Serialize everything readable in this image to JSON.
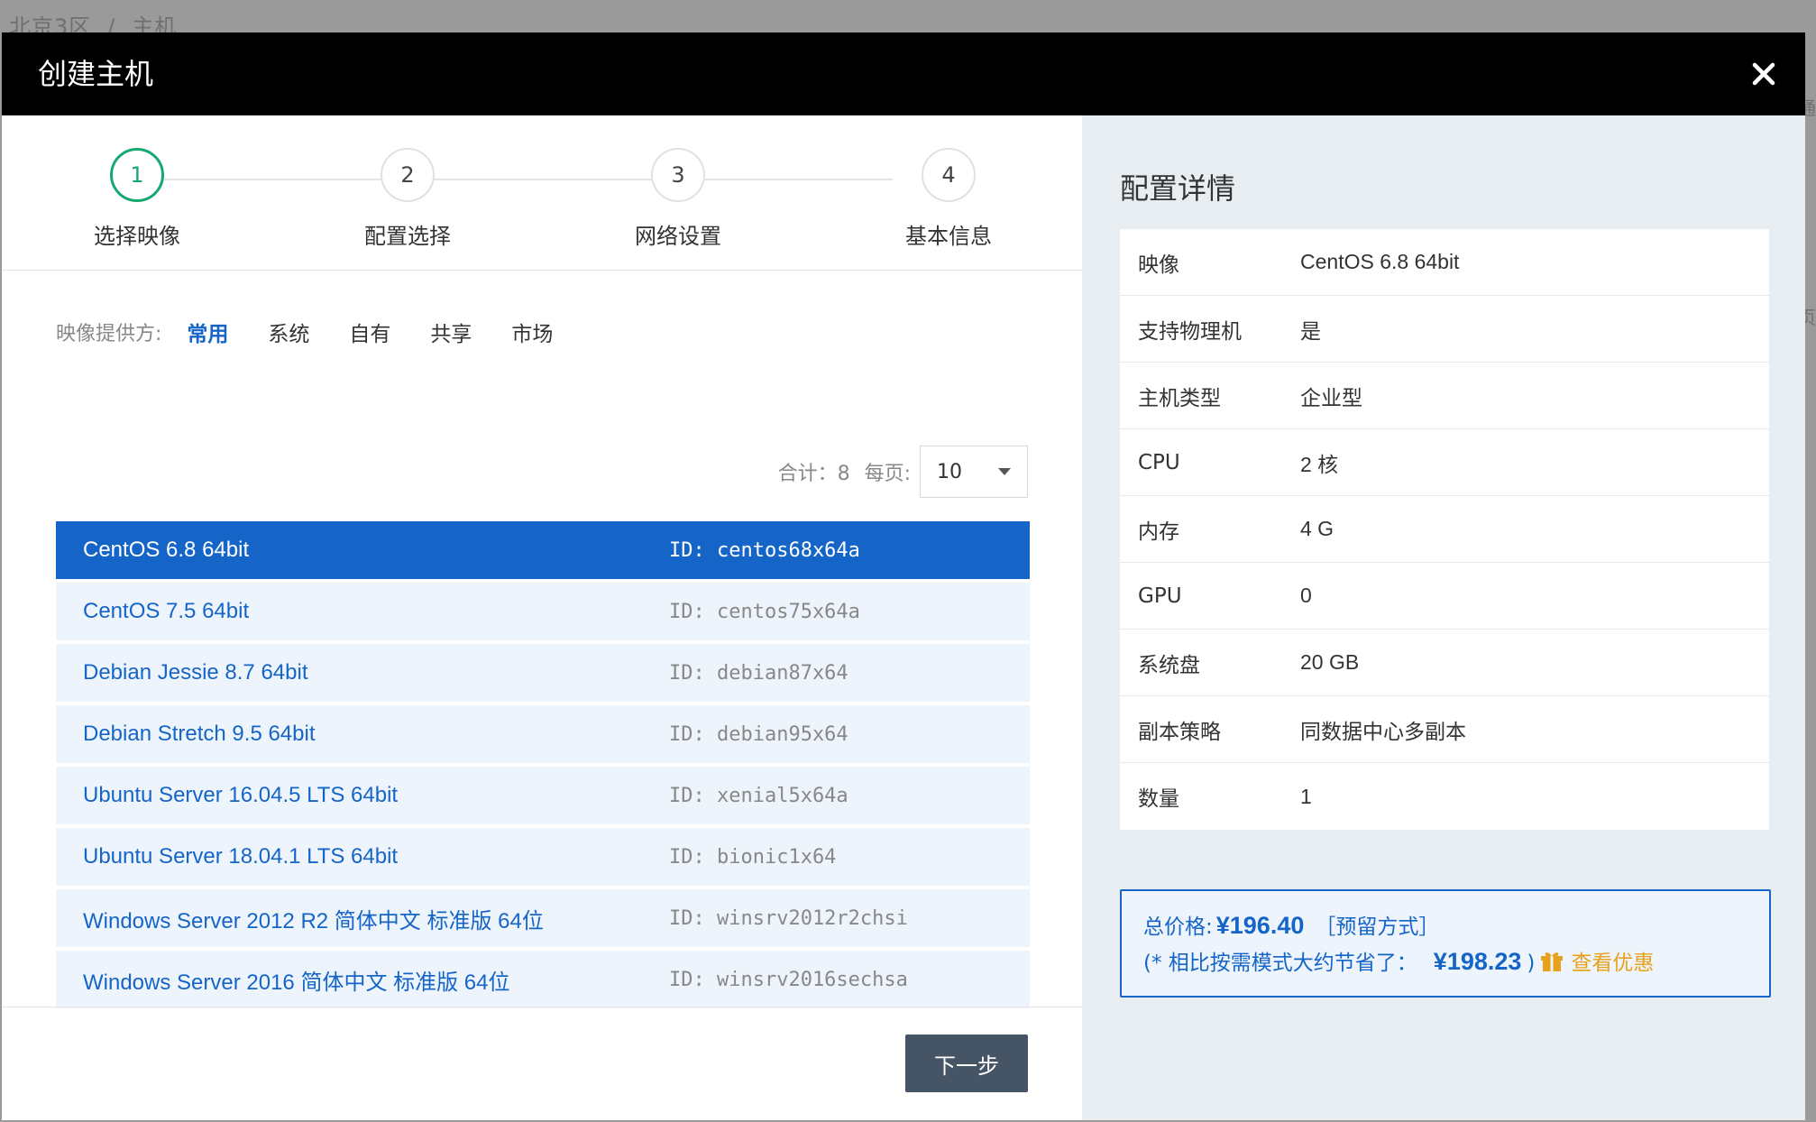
{
  "background": {
    "breadcrumb": [
      "北京3区",
      "主机"
    ],
    "peek_right_1": "通",
    "peek_right_2": "页"
  },
  "modal": {
    "title": "创建主机",
    "close_icon": "close-icon"
  },
  "steps": [
    {
      "number": "1",
      "label": "选择映像",
      "active": true
    },
    {
      "number": "2",
      "label": "配置选择",
      "active": false
    },
    {
      "number": "3",
      "label": "网络设置",
      "active": false
    },
    {
      "number": "4",
      "label": "基本信息",
      "active": false
    }
  ],
  "provider": {
    "label": "映像提供方:",
    "tabs": [
      "常用",
      "系统",
      "自有",
      "共享",
      "市场"
    ],
    "active_index": 0
  },
  "pager": {
    "total_label": "合计：8",
    "per_page_label": "每页:",
    "per_page_value": "10"
  },
  "images": [
    {
      "name": "CentOS 6.8 64bit",
      "id": "ID: centos68x64a",
      "selected": true
    },
    {
      "name": "CentOS 7.5 64bit",
      "id": "ID: centos75x64a",
      "selected": false
    },
    {
      "name": "Debian Jessie 8.7 64bit",
      "id": "ID: debian87x64",
      "selected": false
    },
    {
      "name": "Debian Stretch 9.5 64bit",
      "id": "ID: debian95x64",
      "selected": false
    },
    {
      "name": "Ubuntu Server 16.04.5 LTS 64bit",
      "id": "ID: xenial5x64a",
      "selected": false
    },
    {
      "name": "Ubuntu Server 18.04.1 LTS 64bit",
      "id": "ID: bionic1x64",
      "selected": false
    },
    {
      "name": "Windows Server 2012 R2 简体中文 标准版 64位",
      "id": "ID: winsrv2012r2chsi",
      "selected": false
    },
    {
      "name": "Windows Server 2016 简体中文 标准版 64位",
      "id": "ID: winsrv2016sechsa",
      "selected": false
    }
  ],
  "footer": {
    "next_label": "下一步"
  },
  "details": {
    "title": "配置详情",
    "rows": [
      {
        "key": "映像",
        "value": "CentOS 6.8 64bit"
      },
      {
        "key": "支持物理机",
        "value": "是"
      },
      {
        "key": "主机类型",
        "value": "企业型"
      },
      {
        "key": "CPU",
        "value": "2 核"
      },
      {
        "key": "内存",
        "value": "4 G"
      },
      {
        "key": "GPU",
        "value": "0"
      },
      {
        "key": "系统盘",
        "value": "20 GB"
      },
      {
        "key": "副本策略",
        "value": "同数据中心多副本"
      },
      {
        "key": "数量",
        "value": "1"
      }
    ]
  },
  "price": {
    "total_label": "总价格:",
    "total_amount": "¥196.40",
    "mode": "［预留方式］",
    "save_prefix": "(* 相比按需模式大约节省了：",
    "save_amount": "¥198.23",
    "save_suffix": ")",
    "discount_link": "查看优惠"
  },
  "colors": {
    "primary": "#1565c8",
    "active_step": "#15a871",
    "header_bg": "#000000",
    "next_button": "#455566",
    "discount": "#e8a11a",
    "right_panel_bg": "#e8edf2"
  }
}
